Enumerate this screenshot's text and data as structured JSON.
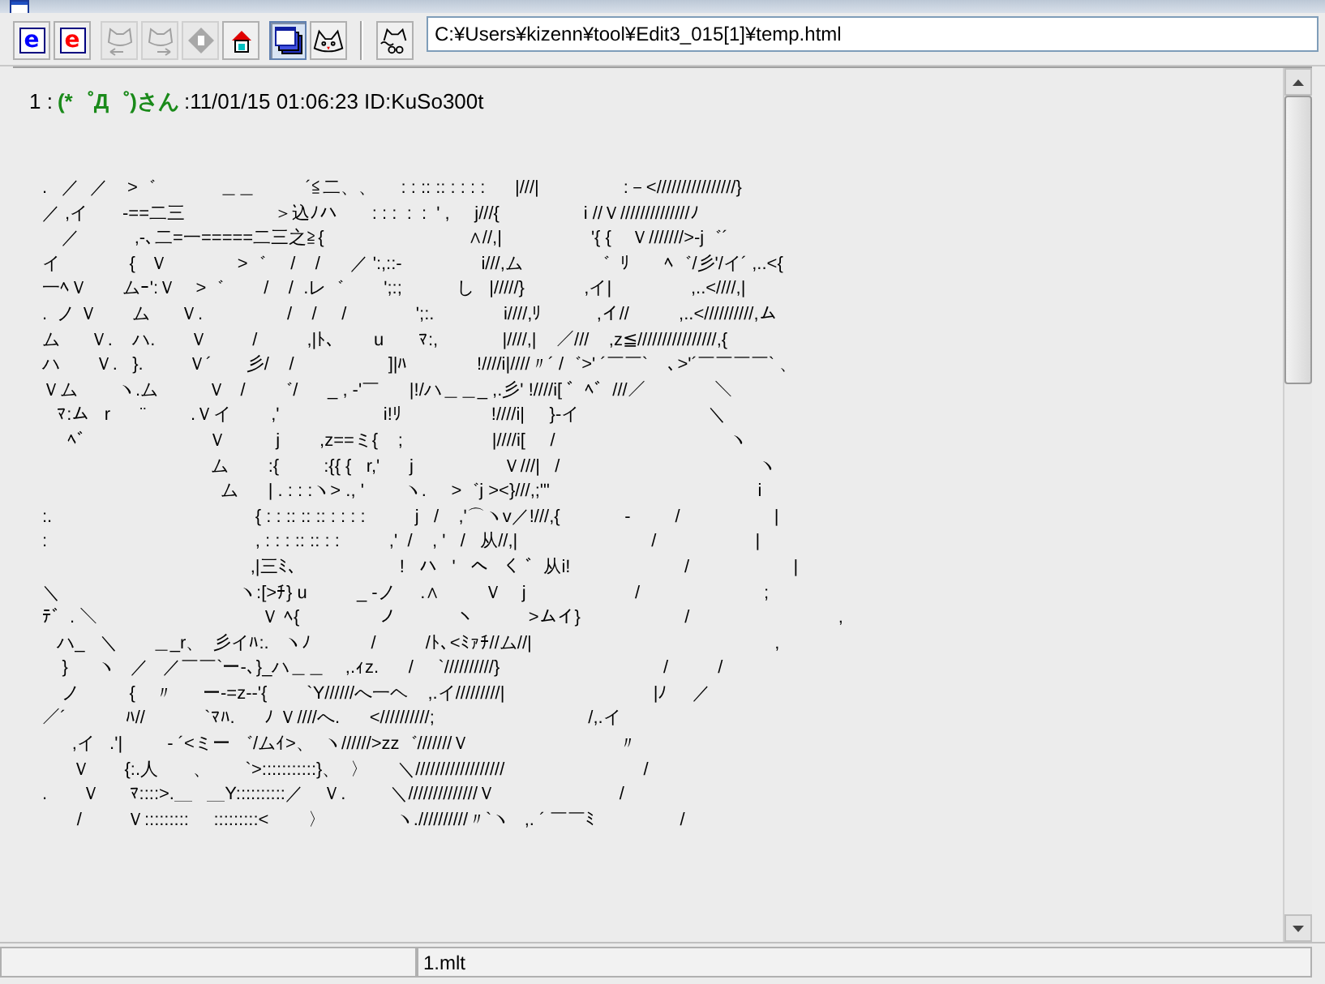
{
  "toolbar": {
    "groups": [
      {
        "divider": false,
        "buttons": [
          {
            "kind": "e",
            "glyph": "e",
            "color": "#0000ff",
            "disabled": false,
            "selected": false
          },
          {
            "kind": "e",
            "glyph": "e",
            "color": "#ff0000",
            "disabled": false,
            "selected": false
          }
        ]
      },
      {
        "divider": false,
        "buttons": [
          {
            "kind": "cat-back",
            "disabled": true,
            "selected": false
          },
          {
            "kind": "cat-forward",
            "disabled": true,
            "selected": false
          },
          {
            "kind": "stop",
            "disabled": true,
            "selected": false
          },
          {
            "kind": "home",
            "disabled": false,
            "selected": false
          }
        ]
      },
      {
        "divider": false,
        "buttons": [
          {
            "kind": "windows",
            "disabled": false,
            "selected": true
          },
          {
            "kind": "cat",
            "disabled": false,
            "selected": false
          }
        ]
      },
      {
        "divider": true,
        "buttons": [
          {
            "kind": "cat-tilde",
            "disabled": false,
            "selected": false
          }
        ]
      }
    ],
    "address": {
      "value": "C:¥Users¥kizenn¥tool¥Edit3_015[1]¥temp.html"
    }
  },
  "post": {
    "number": "1 :",
    "name": "(*゜Д゜)さん",
    "info": ":11/01/15 01:06:23 ID:KuSo300t",
    "art_lines": [
      ".   ／  ／    >゛             ＿＿          ´≦二、、     : : :: :: : : : :      |///|                 :－<////////////////}",
      "／ ,イ       -==二三                  ＞込ﾉハ       : : :  :  :  ' ,     j///{                 i //Ｖ//////////////ﾉ",
      "    ／           ,-､二=一=====二三之≧{                             ∧//,|                  '{ {    Ｖ///////>-j゛´",
      "イ              {   Ｖ              >゛     /    /      ／ ':,::-                i///,ム              ゛  ﾘ       ﾍ゛/彡'/イ´ ,..<{",
      "一ﾍＶ       ムｰ':Ｖ    >゛        /    /  .レ゛        ';:;           し   |/////}            ,イ|                ,..<////,|",
      ".  ノ Ｖ       ム      Ｖ.                 /    /     /              ';:.              i////,ﾘ           ,イ//          ,..<//////////,ム",
      "ム      Ｖ.    ハ.       Ｖ         /          ,|ﾄ、      u       ﾏ:,             |////,|    ／///    ,z≦////////////////,{",
      "ハ       Ｖ.   }.         Ｖ´       彡/    /                   ]|ﾊ              !////i|////〃´ /゛>' ´￣￣`    ､>'´￣￣￣￣` 、",
      "Ｖム        ヽ.ム          Ｖ   /      ゛/      _ , ‐'￣      |!/ハ＿＿_ ,.彡' !////i[ ゛ﾍ゛///／              ＼",
      "   ﾏ:ム   r      ¨         .Ｖイ        ,'                     i!ﾘ                  !////i|     }-イ                          ＼",
      "     ﾍ゛                       Ｖ          j        ,z==ミ{    ;                  |////i[     /                                   ヽ",
      "                                  ム        :{         :{{ {   r,'      j                  Ｖ///|   /                                        ヽ",
      "                                    ム      | . : : :ヽ> ., '        ヽ.     >゛j ><}///,;'\"                                          i",
      ":.                                         { : : :: :: :: : : : :          j   /    ,'⌒ヽv／!///,{             ‐         /                   |",
      ":                                          , : : : :: :: : :          ,'  /    , '   /   从//,|                           /                    |",
      "                                          ,|三ﾐ、                   !   ハ   '   へ   く ゛从i!                       /                     |",
      "＼                                    ヽ:[>ﾁ} u          _ ‐ノ     .∧         Ｖ    j                      /                         ;",
      "ﾃ゛. ＼                                 Ｖ ﾍ{                ノ            ヽ           >ムイ}                     /                              ,",
      "   ハ_   ＼       ＿_r、  彡イﾊ:.   ヽﾉ            /          /ﾄ､<ﾐｧﾁ//ム//|                                                 ,",
      "    }      ヽ   ／   ／￣￣`ー-､}_ハ＿＿    ,.ｨz.      /     `//////////}                                 /          /",
      "    ノ          {    〃      ー-=z--'{        `Y//////へ一ヘ    ,.イ/////////|                              |ﾉ     ／",
      "／´            ﾊ//            `ﾏﾊ.      ﾉ Ｖ////へ.      <//////////;                               /,.イ",
      "      ,イ   .'|         - ´<ミー ゛/ムｲ>、  ヽ//////>zz゛///////Ｖ                              〃",
      "      Ｖ       {:.人       、       `>:::::::::::}、  〉      ＼//////////////////                            /",
      ".       Ｖ      ﾏ::::>.＿   ＿Y::::::::::／    Ｖ.         ＼//////////////Ｖ                         /",
      "       /         Ｖ:::::::::     :::::::::<        〉              ヽ.//////////〃`ヽ   ,. ´ ￣￣ﾐ                 /"
    ]
  },
  "status_bar": {
    "panels": [
      "1.mlt"
    ]
  }
}
